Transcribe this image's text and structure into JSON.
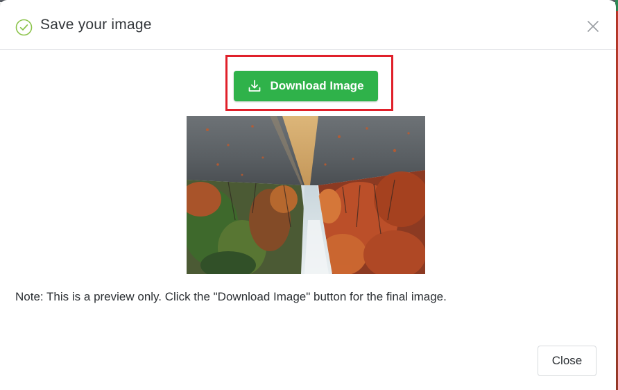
{
  "dialog": {
    "title": "Save your image",
    "download_button_label": "Download Image",
    "note": "Note: This is a preview only. Click the \"Download Image\" button for the final image.",
    "close_button_label": "Close"
  },
  "preview": {
    "alt": "Preview of an upside-down autumn road with trees"
  },
  "colors": {
    "accent_green": "#2fb24a",
    "check_icon_green": "#8bc34a",
    "highlight_red": "#e0202a"
  },
  "icons": {
    "header": "check-circle-icon",
    "close": "close-icon",
    "download": "download-icon"
  }
}
